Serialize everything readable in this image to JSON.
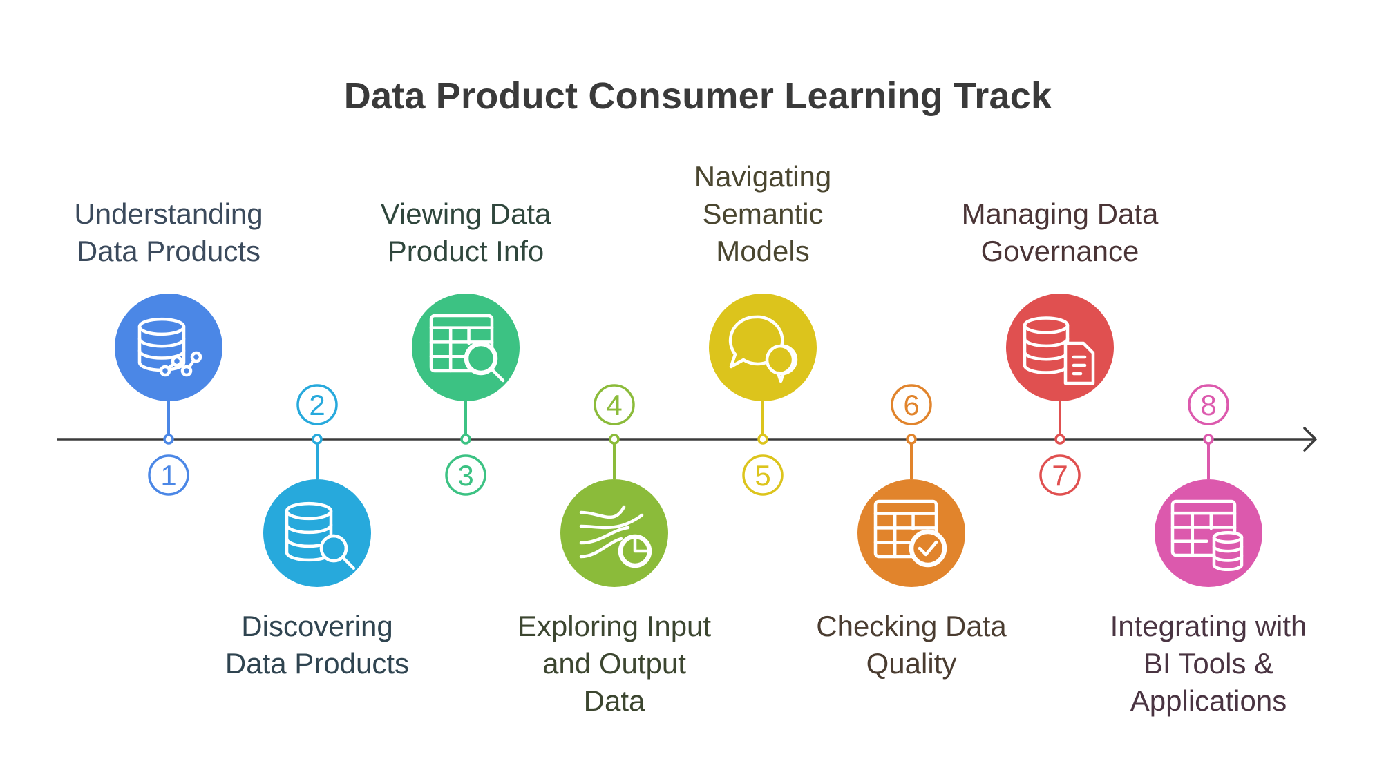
{
  "title": "Data Product Consumer Learning Track",
  "steps": [
    {
      "number": "1",
      "lines": [
        "Understanding",
        "Data Products"
      ],
      "icon": "database-graph-icon",
      "color": "#4b87e6",
      "text_color": "#3b4a5c"
    },
    {
      "number": "2",
      "lines": [
        "Discovering",
        "Data Products"
      ],
      "icon": "database-search-icon",
      "color": "#27a9dc",
      "text_color": "#2f4450"
    },
    {
      "number": "3",
      "lines": [
        "Viewing Data",
        "Product Info"
      ],
      "icon": "table-search-icon",
      "color": "#3cc283",
      "text_color": "#2f463c"
    },
    {
      "number": "4",
      "lines": [
        "Exploring Input",
        "and Output",
        "Data"
      ],
      "icon": "flow-pie-icon",
      "color": "#8bbb3a",
      "text_color": "#3c4630"
    },
    {
      "number": "5",
      "lines": [
        "Navigating",
        "Semantic",
        "Models"
      ],
      "icon": "chat-bubbles-icon",
      "color": "#dcc41c",
      "text_color": "#4a4630"
    },
    {
      "number": "6",
      "lines": [
        "Checking Data",
        "Quality"
      ],
      "icon": "table-check-icon",
      "color": "#e1842c",
      "text_color": "#4a3c30"
    },
    {
      "number": "7",
      "lines": [
        "Managing Data",
        "Governance"
      ],
      "icon": "database-document-icon",
      "color": "#e05050",
      "text_color": "#4a3436"
    },
    {
      "number": "8",
      "lines": [
        "Integrating with",
        "BI Tools &",
        "Applications"
      ],
      "icon": "table-database-icon",
      "color": "#dc59ad",
      "text_color": "#4a3442"
    }
  ]
}
